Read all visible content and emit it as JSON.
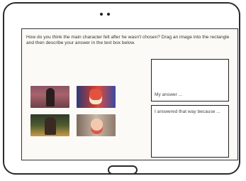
{
  "activity": {
    "prompt": "How do you think the main character felt after he wasn't chosen? Drag an image into the rectangle and then describe your answer in the text box below.",
    "answer_drop_label": "My answer ...",
    "reason_placeholder": "I answered that way because ..."
  },
  "images": [
    {
      "icon": "woman-gesturing-image"
    },
    {
      "icon": "angry-character-image"
    },
    {
      "icon": "upset-man-image"
    },
    {
      "icon": "worried-character-image"
    }
  ]
}
